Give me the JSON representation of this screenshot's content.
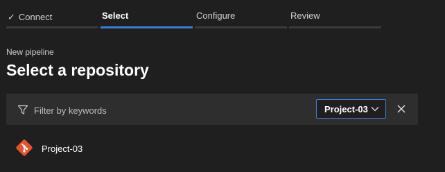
{
  "wizard": {
    "steps": [
      {
        "label": "Connect",
        "state": "done"
      },
      {
        "label": "Select",
        "state": "active"
      },
      {
        "label": "Configure",
        "state": "pending"
      },
      {
        "label": "Review",
        "state": "pending"
      }
    ]
  },
  "header": {
    "subtitle": "New pipeline",
    "title": "Select a repository"
  },
  "filter": {
    "placeholder": "Filter by keywords",
    "project_dropdown": "Project-03"
  },
  "repositories": [
    {
      "name": "Project-03",
      "icon": "git-icon"
    }
  ],
  "colors": {
    "background": "#1f1f1f",
    "accent": "#3b7fd4",
    "git_brand": "#e4532f"
  }
}
